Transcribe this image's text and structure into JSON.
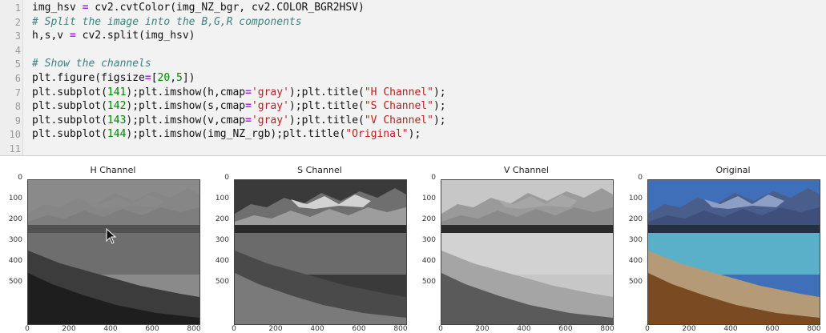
{
  "code_lines": [
    {
      "n": "1",
      "parts": [
        [
          "plain",
          "img_hsv "
        ],
        [
          "op",
          "="
        ],
        [
          "plain",
          " cv2.cvtColor(img_NZ_bgr, cv2.COLOR_BGR2HSV)"
        ]
      ]
    },
    {
      "n": "2",
      "parts": [
        [
          "cm",
          "# Split the image into the B,G,R components"
        ]
      ]
    },
    {
      "n": "3",
      "parts": [
        [
          "plain",
          "h,s,v "
        ],
        [
          "op",
          "="
        ],
        [
          "plain",
          " cv2.split(img_hsv)"
        ]
      ]
    },
    {
      "n": "4",
      "parts": []
    },
    {
      "n": "5",
      "parts": [
        [
          "cm",
          "# Show the channels"
        ]
      ]
    },
    {
      "n": "6",
      "parts": [
        [
          "plain",
          "plt.figure(figsize"
        ],
        [
          "op",
          "="
        ],
        [
          "plain",
          "["
        ],
        [
          "num",
          "20"
        ],
        [
          "plain",
          ","
        ],
        [
          "num",
          "5"
        ],
        [
          "plain",
          "])"
        ]
      ]
    },
    {
      "n": "7",
      "parts": [
        [
          "plain",
          "plt.subplot("
        ],
        [
          "num",
          "141"
        ],
        [
          "plain",
          ");plt.imshow(h,cmap"
        ],
        [
          "op",
          "="
        ],
        [
          "str",
          "'gray'"
        ],
        [
          "plain",
          ");plt.title("
        ],
        [
          "str",
          "\"H Channel\""
        ],
        [
          "plain",
          ");"
        ]
      ]
    },
    {
      "n": "8",
      "parts": [
        [
          "plain",
          "plt.subplot("
        ],
        [
          "num",
          "142"
        ],
        [
          "plain",
          ");plt.imshow(s,cmap"
        ],
        [
          "op",
          "="
        ],
        [
          "str",
          "'gray'"
        ],
        [
          "plain",
          ");plt.title("
        ],
        [
          "str",
          "\"S Channel\""
        ],
        [
          "plain",
          ");"
        ]
      ]
    },
    {
      "n": "9",
      "parts": [
        [
          "plain",
          "plt.subplot("
        ],
        [
          "num",
          "143"
        ],
        [
          "plain",
          ");plt.imshow(v,cmap"
        ],
        [
          "op",
          "="
        ],
        [
          "str",
          "'gray'"
        ],
        [
          "plain",
          ");plt.title("
        ],
        [
          "str",
          "\"V Channel\""
        ],
        [
          "plain",
          ");"
        ]
      ]
    },
    {
      "n": "10",
      "parts": [
        [
          "plain",
          "plt.subplot("
        ],
        [
          "num",
          "144"
        ],
        [
          "plain",
          ");plt.imshow(img_NZ_rgb);plt.title("
        ],
        [
          "str",
          "\"Original\""
        ],
        [
          "plain",
          ");"
        ]
      ]
    },
    {
      "n": "11",
      "parts": []
    }
  ],
  "panels": [
    {
      "title": "H Channel",
      "kind": "h"
    },
    {
      "title": "S Channel",
      "kind": "s"
    },
    {
      "title": "V Channel",
      "kind": "v"
    },
    {
      "title": "Original",
      "kind": "rgb"
    }
  ],
  "y_ticks": [
    "0",
    "100",
    "200",
    "300",
    "400",
    "500"
  ],
  "x_ticks": [
    "0",
    "200",
    "400",
    "600",
    "800"
  ]
}
